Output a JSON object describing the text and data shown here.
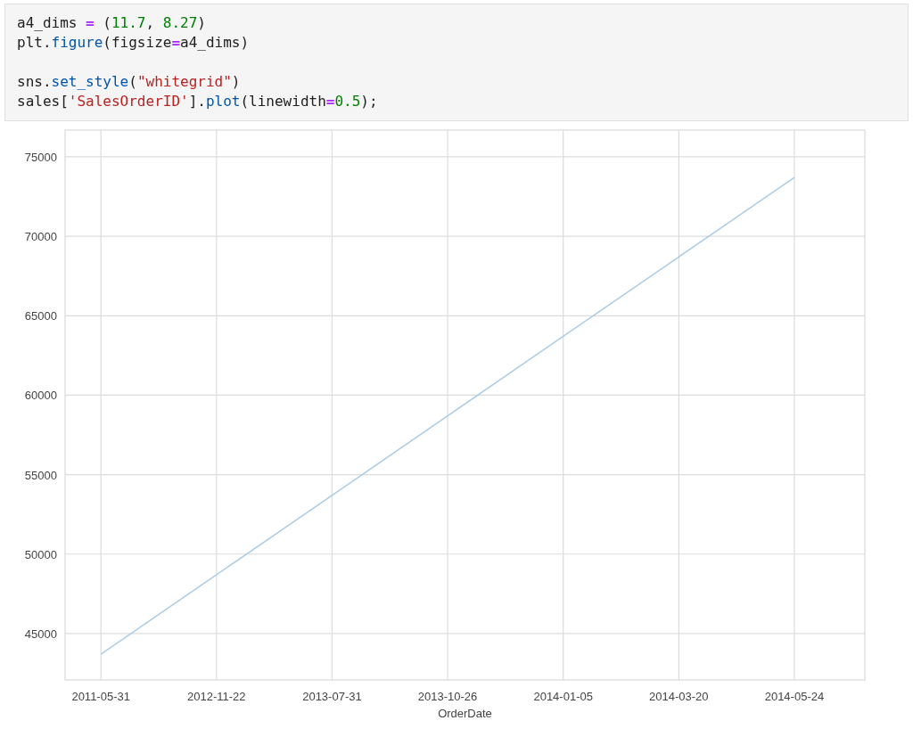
{
  "code_cell": {
    "blocks": [
      [
        [
          {
            "text": "a4_dims ",
            "kind": "plain"
          },
          {
            "text": "=",
            "kind": "op"
          },
          {
            "text": " (",
            "kind": "plain"
          },
          {
            "text": "11.7",
            "kind": "number"
          },
          {
            "text": ", ",
            "kind": "plain"
          },
          {
            "text": "8.27",
            "kind": "number"
          },
          {
            "text": ")",
            "kind": "plain"
          }
        ],
        [
          {
            "text": "plt.",
            "kind": "plain"
          },
          {
            "text": "figure",
            "kind": "func"
          },
          {
            "text": "(figsize",
            "kind": "plain"
          },
          {
            "text": "=",
            "kind": "op"
          },
          {
            "text": "a4_dims)",
            "kind": "plain"
          }
        ]
      ],
      [
        [
          {
            "text": "sns.",
            "kind": "plain"
          },
          {
            "text": "set_style",
            "kind": "func"
          },
          {
            "text": "(",
            "kind": "plain"
          },
          {
            "text": "\"whitegrid\"",
            "kind": "string"
          },
          {
            "text": ")",
            "kind": "plain"
          }
        ],
        [
          {
            "text": "sales[",
            "kind": "plain"
          },
          {
            "text": "'SalesOrderID'",
            "kind": "string"
          },
          {
            "text": "].",
            "kind": "plain"
          },
          {
            "text": "plot",
            "kind": "func"
          },
          {
            "text": "(linewidth",
            "kind": "plain"
          },
          {
            "text": "=",
            "kind": "op"
          },
          {
            "text": "0.5",
            "kind": "number"
          },
          {
            "text": ");",
            "kind": "plain"
          }
        ]
      ]
    ]
  },
  "output": {
    "chart_data": {
      "type": "line",
      "xlabel": "OrderDate",
      "categories": [
        "2011-05-31",
        "2012-11-22",
        "2013-07-31",
        "2013-10-26",
        "2014-01-05",
        "2014-03-20",
        "2014-05-24"
      ],
      "series": [
        {
          "color": "#aecde6",
          "values": [
            43700,
            48700,
            53700,
            58700,
            63700,
            68700,
            73700
          ]
        }
      ],
      "ylim": [
        42080,
        76680
      ],
      "grid": true,
      "yticks": [
        {
          "value": 45000,
          "label": "45000"
        },
        {
          "value": 50000,
          "label": "50000"
        },
        {
          "value": 55000,
          "label": "55000"
        },
        {
          "value": 60000,
          "label": "60000"
        },
        {
          "value": 65000,
          "label": "65000"
        },
        {
          "value": 70000,
          "label": "70000"
        },
        {
          "value": 75000,
          "label": "75000"
        }
      ]
    }
  }
}
